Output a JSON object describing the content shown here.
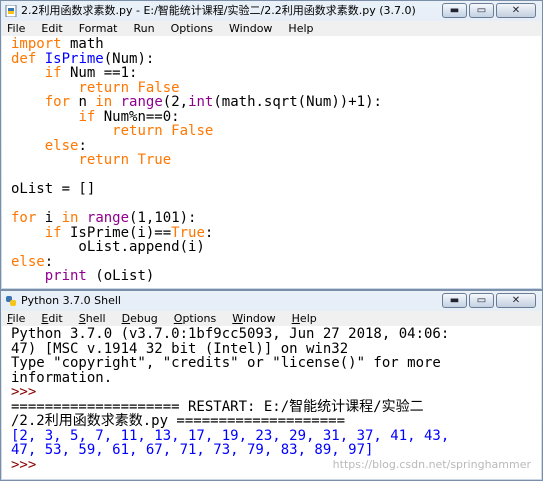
{
  "editor": {
    "title": "2.2利用函数求素数.py - E:/智能统计课程/实验二/2.2利用函数求素数.py (3.7.0)",
    "menu": [
      "File",
      "Edit",
      "Format",
      "Run",
      "Options",
      "Window",
      "Help"
    ],
    "code": [
      [
        {
          "t": "import",
          "c": "kw"
        },
        {
          "t": " math"
        }
      ],
      [
        {
          "t": "def",
          "c": "kw"
        },
        {
          "t": " "
        },
        {
          "t": "IsPrime",
          "c": "df"
        },
        {
          "t": "(Num):"
        }
      ],
      [
        {
          "t": "    "
        },
        {
          "t": "if",
          "c": "kw"
        },
        {
          "t": " Num ==1:"
        }
      ],
      [
        {
          "t": "        "
        },
        {
          "t": "return",
          "c": "kw"
        },
        {
          "t": " "
        },
        {
          "t": "False",
          "c": "kw"
        }
      ],
      [
        {
          "t": "    "
        },
        {
          "t": "for",
          "c": "kw"
        },
        {
          "t": " n "
        },
        {
          "t": "in",
          "c": "kw"
        },
        {
          "t": " "
        },
        {
          "t": "range",
          "c": "bi"
        },
        {
          "t": "(2,"
        },
        {
          "t": "int",
          "c": "bi"
        },
        {
          "t": "(math.sqrt(Num))+1):"
        }
      ],
      [
        {
          "t": "        "
        },
        {
          "t": "if",
          "c": "kw"
        },
        {
          "t": " Num%n==0:"
        }
      ],
      [
        {
          "t": "            "
        },
        {
          "t": "return",
          "c": "kw"
        },
        {
          "t": " "
        },
        {
          "t": "False",
          "c": "kw"
        }
      ],
      [
        {
          "t": "    "
        },
        {
          "t": "else",
          "c": "kw"
        },
        {
          "t": ":"
        }
      ],
      [
        {
          "t": "        "
        },
        {
          "t": "return",
          "c": "kw"
        },
        {
          "t": " "
        },
        {
          "t": "True",
          "c": "kw"
        }
      ],
      [
        {
          "t": ""
        }
      ],
      [
        {
          "t": "oList = []"
        }
      ],
      [
        {
          "t": ""
        }
      ],
      [
        {
          "t": "for",
          "c": "kw"
        },
        {
          "t": " i "
        },
        {
          "t": "in",
          "c": "kw"
        },
        {
          "t": " "
        },
        {
          "t": "range",
          "c": "bi"
        },
        {
          "t": "(1,101):"
        }
      ],
      [
        {
          "t": "    "
        },
        {
          "t": "if",
          "c": "kw"
        },
        {
          "t": " IsPrime(i)=="
        },
        {
          "t": "True",
          "c": "kw"
        },
        {
          "t": ":"
        }
      ],
      [
        {
          "t": "        oList.append(i)"
        }
      ],
      [
        {
          "t": "else",
          "c": "kw"
        },
        {
          "t": ":"
        }
      ],
      [
        {
          "t": "    "
        },
        {
          "t": "print",
          "c": "bi"
        },
        {
          "t": " (oList)"
        }
      ]
    ]
  },
  "shell": {
    "title": "Python 3.7.0 Shell",
    "menu": [
      "File",
      "Edit",
      "Shell",
      "Debug",
      "Options",
      "Window",
      "Help"
    ],
    "lines": [
      [
        {
          "t": "Python 3.7.0 (v3.7.0:1bf9cc5093, Jun 27 2018, 04:06:"
        }
      ],
      [
        {
          "t": "47) [MSC v.1914 32 bit (Intel)] on win32"
        }
      ],
      [
        {
          "t": "Type \"copyright\", \"credits\" or \"license()\" for more"
        }
      ],
      [
        {
          "t": "information."
        }
      ],
      [
        {
          "t": ">>> ",
          "c": "prompt"
        }
      ],
      [
        {
          "t": "==================== RESTART: E:/智能统计课程/实验二"
        }
      ],
      [
        {
          "t": "/2.2利用函数求素数.py ===================="
        }
      ],
      [
        {
          "t": "[2, 3, 5, 7, 11, 13, 17, 19, 23, 29, 31, 37, 41, 43,",
          "c": "out"
        }
      ],
      [
        {
          "t": "47, 53, 59, 61, 67, 71, 73, 79, 83, 89, 97]",
          "c": "out"
        }
      ],
      [
        {
          "t": ">>> ",
          "c": "prompt"
        }
      ]
    ]
  },
  "watermark": "https://blog.csdn.net/springhammer",
  "colors": {
    "keyword": "#ff7700",
    "builtin": "#900090",
    "definition": "#0000ff",
    "output": "#0000ff",
    "prompt": "#8b0000"
  }
}
